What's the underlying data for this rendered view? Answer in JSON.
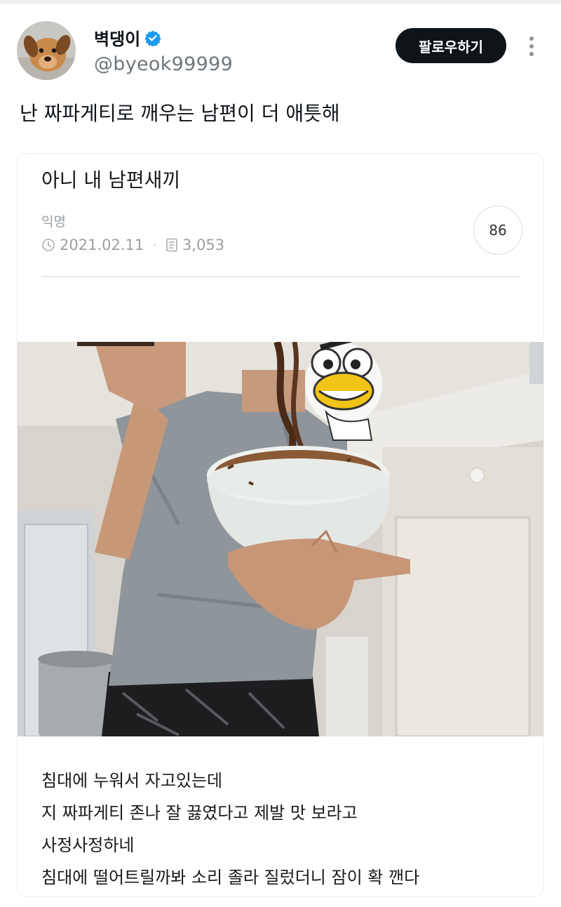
{
  "user": {
    "display_name": "벽댕이",
    "handle": "@byeok99999",
    "verified": true
  },
  "follow_button_label": "팔로우하기",
  "tweet_text": "난 짜파게티로 깨우는 남편이 더 애틋해",
  "quoted_post": {
    "title": "아니 내 남편새끼",
    "author": "익명",
    "date": "2021.02.11",
    "views": "3,053",
    "comment_count": "86",
    "body_lines": [
      "침대에 누워서 자고있는데",
      "지 짜파게티 존나 잘 끓였다고 제발 맛 보라고",
      "사정사정하네",
      "침대에 떨어트릴까봐 소리 졸라 질렀더니 잠이 확 깬다"
    ]
  },
  "icons": {
    "verified": "verified-badge-icon",
    "more": "more-vertical-icon",
    "date": "clock-icon",
    "views": "document-icon"
  },
  "colors": {
    "verified_blue": "#1d9bf0",
    "follow_bg": "#0f1419",
    "muted_text": "#9a9ea3"
  }
}
